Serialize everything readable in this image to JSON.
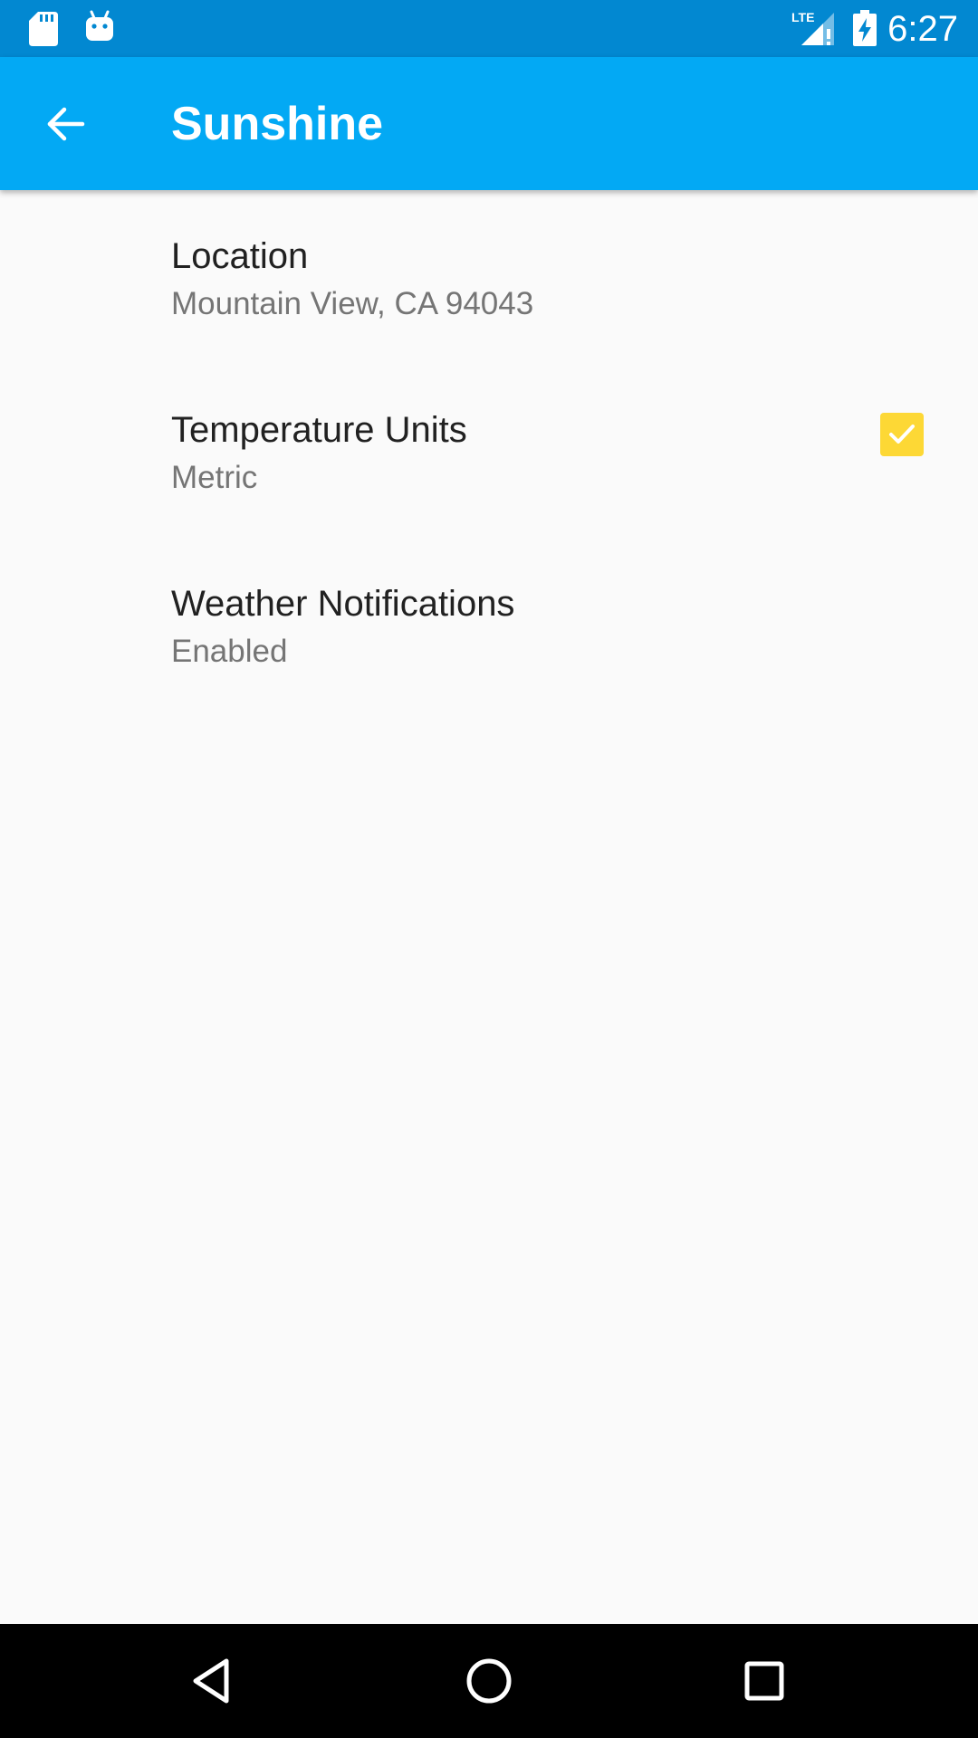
{
  "status_bar": {
    "time": "6:27",
    "network_label": "LTE",
    "icons": [
      "sd-card-icon",
      "android-icon",
      "lte-signal-icon",
      "battery-charging-icon"
    ],
    "background_color": "#0288d1"
  },
  "app_bar": {
    "title": "Sunshine",
    "back_icon": "arrow-back-icon",
    "background_color": "#03a9f4"
  },
  "preferences": [
    {
      "title": "Location",
      "summary": "Mountain View, CA 94043"
    },
    {
      "title": "Temperature Units",
      "summary": "Metric"
    },
    {
      "title": "Weather Notifications",
      "summary": "Enabled",
      "checked": true,
      "accent_color": "#fdd835"
    }
  ],
  "nav_bar": {
    "buttons": [
      "back-triangle-icon",
      "home-circle-icon",
      "recents-square-icon"
    ]
  }
}
